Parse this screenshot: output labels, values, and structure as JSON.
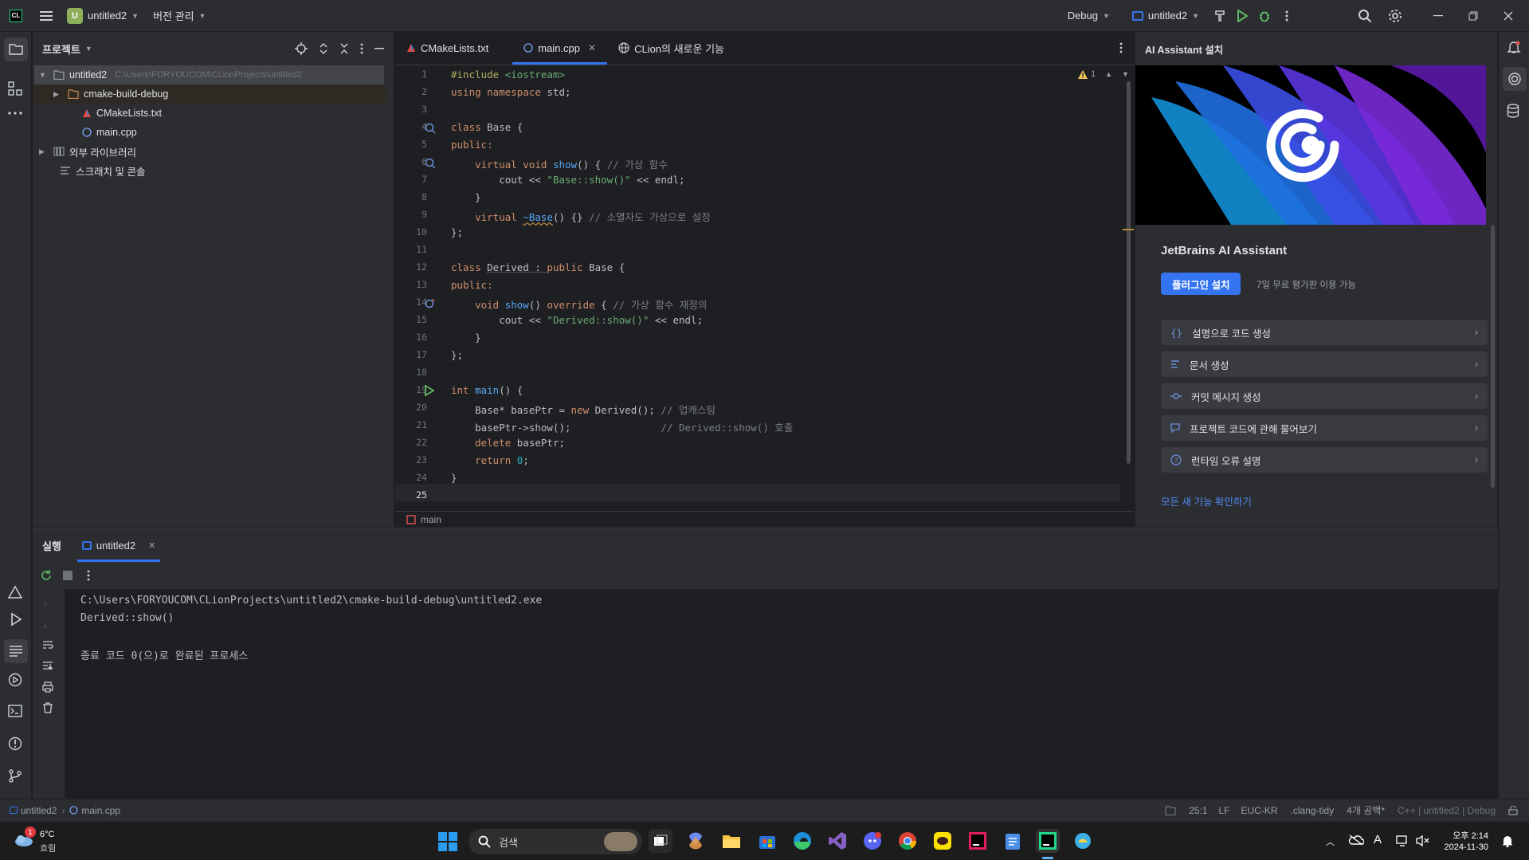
{
  "topbar": {
    "app_logo": "CL",
    "project_badge": "U",
    "project_name": "untitled2",
    "vcs_label": "버전 관리",
    "config_label": "Debug",
    "run_target": "untitled2"
  },
  "project_panel": {
    "title": "프로젝트",
    "tree": [
      {
        "label": "untitled2",
        "path": "C:\\Users\\FORYOUCOM\\CLionProjects\\untitled2",
        "indent": 0
      },
      {
        "label": "cmake-build-debug",
        "indent": 1
      },
      {
        "label": "CMakeLists.txt",
        "indent": 2
      },
      {
        "label": "main.cpp",
        "indent": 2
      },
      {
        "label": "외부 라이브러리",
        "indent": 0
      },
      {
        "label": "스크래치 및 콘솔",
        "indent": 0
      }
    ]
  },
  "editor": {
    "tabs": [
      {
        "label": "CMakeLists.txt"
      },
      {
        "label": "main.cpp"
      },
      {
        "label": "CLion의 새로운 기능"
      }
    ],
    "inspection_count": "1",
    "breadcrumb": "main",
    "lines": [
      "1",
      "2",
      "3",
      "4",
      "5",
      "6",
      "7",
      "8",
      "9",
      "10",
      "11",
      "12",
      "13",
      "14",
      "15",
      "16",
      "17",
      "18",
      "19",
      "20",
      "21",
      "22",
      "23",
      "24",
      "25"
    ],
    "code": {
      "l1a": "#include ",
      "l1b": "<iostream>",
      "l2a": "using namespace ",
      "l2b": "std;",
      "l4a": "class ",
      "l4b": "Base {",
      "l5": "public:",
      "l6a": "    virtual void ",
      "l6b": "show",
      "l6c": "() { ",
      "l6d": "// 가상 함수",
      "l7a": "        cout << ",
      "l7b": "\"Base::show()\"",
      "l7c": " << endl;",
      "l8": "    }",
      "l9a": "    virtual ",
      "l9b": "~Base",
      "l9c": "() {} ",
      "l9d": "// 소멸자도 가상으로 설정",
      "l10": "};",
      "l12a": "class ",
      "l12b": "Derived : ",
      "l12c": "public ",
      "l12d": "Base {",
      "l13": "public:",
      "l14a": "    void ",
      "l14b": "show",
      "l14c": "() ",
      "l14d": "override",
      "l14e": " { ",
      "l14f": "// 가상 함수 재정의",
      "l15a": "        cout << ",
      "l15b": "\"Derived::show()\"",
      "l15c": " << endl;",
      "l16": "    }",
      "l17": "};",
      "l19a": "int ",
      "l19b": "main",
      "l19c": "() {",
      "l20a": "    Base* basePtr = ",
      "l20b": "new ",
      "l20c": "Derived(); ",
      "l20d": "// 업캐스팅",
      "l21a": "    basePtr->show();",
      "l21b": "               // Derived::show() 호출",
      "l22a": "    delete ",
      "l22b": "basePtr;",
      "l23a": "    return ",
      "l23b": "0",
      "l23c": ";",
      "l24": "}"
    }
  },
  "ai_panel": {
    "header": "AI Assistant 설치",
    "title": "JetBrains AI Assistant",
    "install_button": "플러그인 설치",
    "trial_note": "7일 무료 평가판 이용 가능",
    "features": [
      {
        "label": "설명으로 코드 생성",
        "icon": "braces-icon"
      },
      {
        "label": "문서 생성",
        "icon": "doc-lines-icon"
      },
      {
        "label": "커밋 메시지 생성",
        "icon": "commit-icon"
      },
      {
        "label": "프로젝트 코드에 관해 물어보기",
        "icon": "chat-icon"
      },
      {
        "label": "런타임 오류 설명",
        "icon": "question-icon"
      }
    ],
    "all_features_link": "모든 새 기능 확인하기"
  },
  "run_panel": {
    "title": "실행",
    "tab_label": "untitled2",
    "console_lines": [
      "C:\\Users\\FORYOUCOM\\CLionProjects\\untitled2\\cmake-build-debug\\untitled2.exe",
      "Derived::show()",
      "",
      "종료 코드 0(으)로 완료된 프로세스"
    ]
  },
  "status_bar": {
    "crumb_project": "untitled2",
    "crumb_file": "main.cpp",
    "position": "25:1",
    "line_sep": "LF",
    "encoding": "EUC-KR",
    "linter": ".clang-tidy",
    "indent": "4개 공백*",
    "context": "C++ | untitled2 | Debug"
  },
  "taskbar": {
    "weather_temp": "6°C",
    "weather_desc": "흐림",
    "weather_badge": "1",
    "search_placeholder": "검색",
    "clock_time": "오후 2:14",
    "clock_date": "2024-11-30"
  },
  "colors": {
    "accent": "#3574f0",
    "run_green": "#5fb865",
    "warning": "#f2c55c"
  }
}
